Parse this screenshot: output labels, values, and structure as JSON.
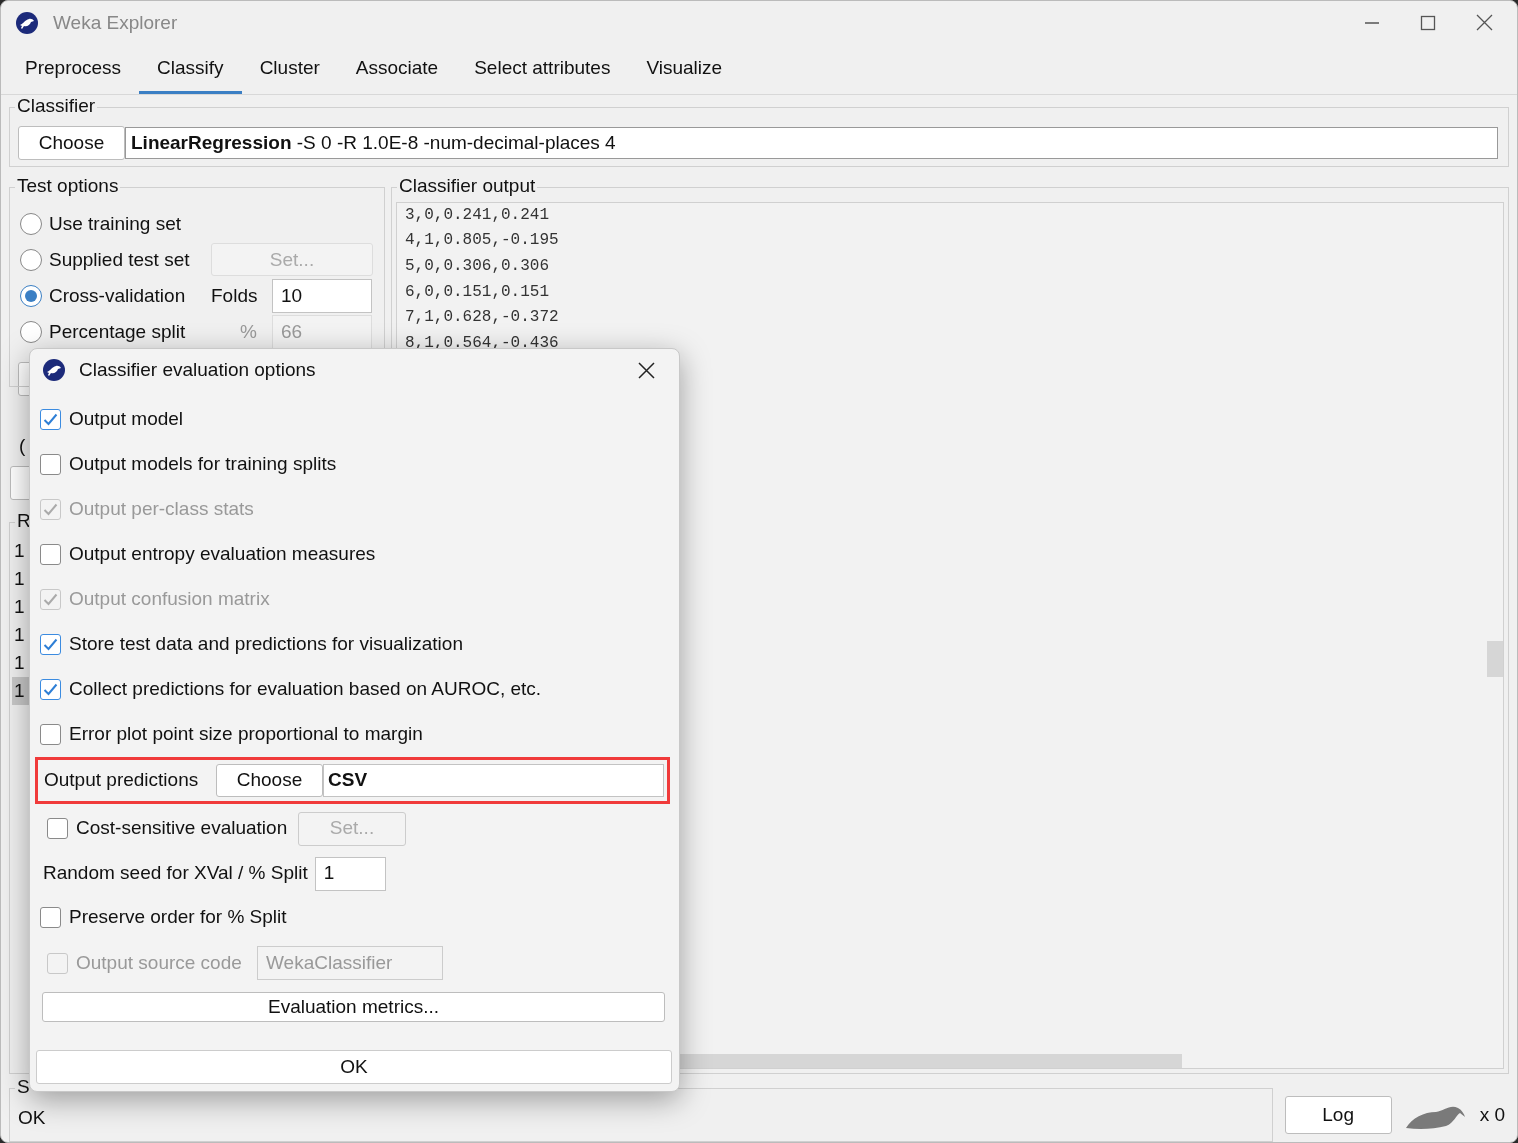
{
  "window": {
    "title": "Weka Explorer"
  },
  "tabs": [
    {
      "label": "Preprocess",
      "selected": false
    },
    {
      "label": "Classify",
      "selected": true
    },
    {
      "label": "Cluster",
      "selected": false
    },
    {
      "label": "Associate",
      "selected": false
    },
    {
      "label": "Select attributes",
      "selected": false
    },
    {
      "label": "Visualize",
      "selected": false
    }
  ],
  "classifier": {
    "legend": "Classifier",
    "choose_button": "Choose",
    "config": "**LinearRegression** -S 0 -R 1.0E-8 -num-decimal-places 4"
  },
  "test_options": {
    "legend": "Test options",
    "options": [
      {
        "label": "Use training set",
        "selected": false
      },
      {
        "label": "Supplied test set",
        "selected": false,
        "button": {
          "label": "Set...",
          "disabled": true
        }
      },
      {
        "label": "Cross-validation",
        "selected": true,
        "field": {
          "label": "Folds",
          "value": "10",
          "disabled": false
        }
      },
      {
        "label": "Percentage split",
        "selected": false,
        "field": {
          "label": "%",
          "value": "66",
          "disabled": true
        }
      }
    ]
  },
  "left_panel": {
    "line_1": "(",
    "result_legend": "R",
    "results": [
      {
        "label": "1",
        "selected": false
      },
      {
        "label": "1",
        "selected": false
      },
      {
        "label": "1",
        "selected": false
      },
      {
        "label": "1",
        "selected": false
      },
      {
        "label": "1",
        "selected": false
      },
      {
        "label": "1",
        "selected": true
      }
    ]
  },
  "output": {
    "legend": "Classifier output",
    "lines": [
      "3,0,0.241,0.241",
      "4,1,0.805,-0.195",
      "5,0,0.306,0.306",
      "6,0,0.151,0.151",
      "7,1,0.628,-0.372",
      "8,1,0.564,-0.436"
    ]
  },
  "status": {
    "legend": "S",
    "message": "OK",
    "log_button": "Log",
    "count": "x 0"
  },
  "dialog": {
    "title": "Classifier evaluation options",
    "checkboxes": [
      {
        "label": "Output model",
        "checked": true,
        "disabled": false
      },
      {
        "label": "Output models for training splits",
        "checked": false,
        "disabled": false
      },
      {
        "label": "Output per-class stats",
        "checked": true,
        "disabled": true
      },
      {
        "label": "Output entropy evaluation measures",
        "checked": false,
        "disabled": false
      },
      {
        "label": "Output confusion matrix",
        "checked": true,
        "disabled": true
      },
      {
        "label": "Store test data and predictions for visualization",
        "checked": true,
        "disabled": false
      },
      {
        "label": "Collect predictions for evaluation based on AUROC, etc.",
        "checked": true,
        "disabled": false
      },
      {
        "label": "Error plot point size proportional to margin",
        "checked": false,
        "disabled": false
      }
    ],
    "output_predictions": {
      "label": "Output predictions",
      "button": "Choose",
      "value": "CSV",
      "highlighted": true
    },
    "cost_sensitive": {
      "label": "Cost-sensitive evaluation",
      "checked": false,
      "button": "Set...",
      "button_disabled": true
    },
    "seed": {
      "label": "Random seed for XVal / % Split",
      "value": "1"
    },
    "preserve_order": {
      "label": "Preserve order for % Split",
      "checked": false
    },
    "source_code": {
      "label": "Output source code",
      "checked": false,
      "disabled": true,
      "value": "WekaClassifier"
    },
    "metrics_button": "Evaluation metrics...",
    "ok_button": "OK"
  }
}
